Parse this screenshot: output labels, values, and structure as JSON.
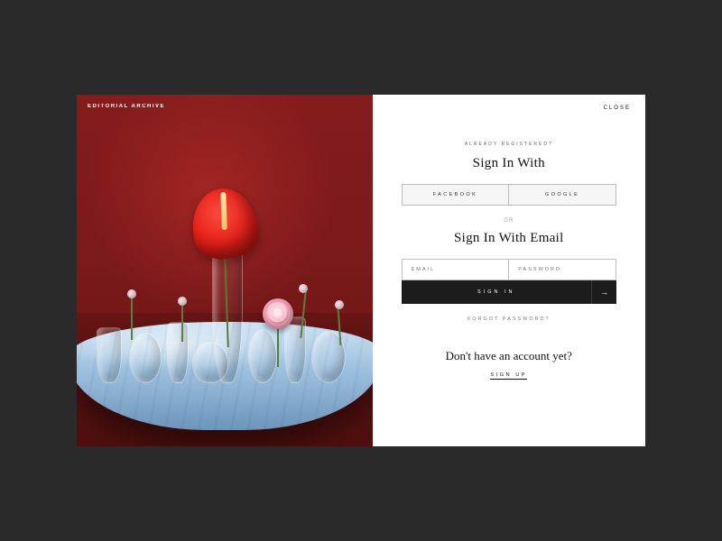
{
  "brand": "EDITORIAL ARCHIVE",
  "close_label": "CLOSE",
  "eyebrow": "ALREADY REGISTERED?",
  "signin_with_heading": "Sign In With",
  "social": {
    "facebook": "FACEBOOK",
    "google": "GOOGLE"
  },
  "or_label": "OR",
  "signin_email_heading": "Sign In With Email",
  "fields": {
    "email_placeholder": "EMAIL",
    "password_placeholder": "PASSWORD"
  },
  "signin_button": "SIGN IN",
  "forgot_label": "FORGOT PASSWORD?",
  "no_account_heading": "Don't have an account yet?",
  "signup_label": "SIGN UP",
  "colors": {
    "page_bg": "#2a2a2a",
    "wall": "#8d1e1e",
    "cloth": "#9dc0de",
    "accent_flower": "#e41f18",
    "signin_btn": "#1c1c1c"
  }
}
